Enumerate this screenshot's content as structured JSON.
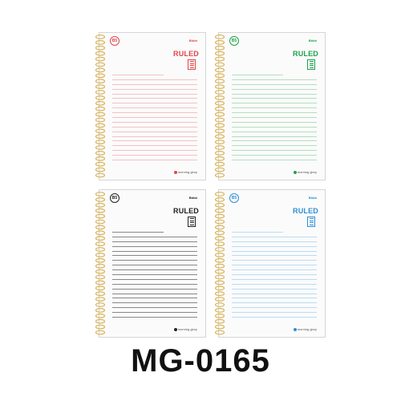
{
  "product_code": "MG-0165",
  "notebooks": [
    {
      "size": "B5",
      "brand": "Bbbb",
      "type": "RULED",
      "logo": "morning glory",
      "color": "#e2464a",
      "line_color": "#f1a8aa"
    },
    {
      "size": "B5",
      "brand": "Bbbb",
      "type": "RULED",
      "logo": "morning glory",
      "color": "#1fa34a",
      "line_color": "#96d2a4"
    },
    {
      "size": "B5",
      "brand": "Bbbb",
      "type": "RULED",
      "logo": "morning glory",
      "color": "#222222",
      "line_color": "#555555"
    },
    {
      "size": "B5",
      "brand": "Bbbb",
      "type": "RULED",
      "logo": "morning glory",
      "color": "#2e8fd6",
      "line_color": "#9fcdf0"
    }
  ]
}
